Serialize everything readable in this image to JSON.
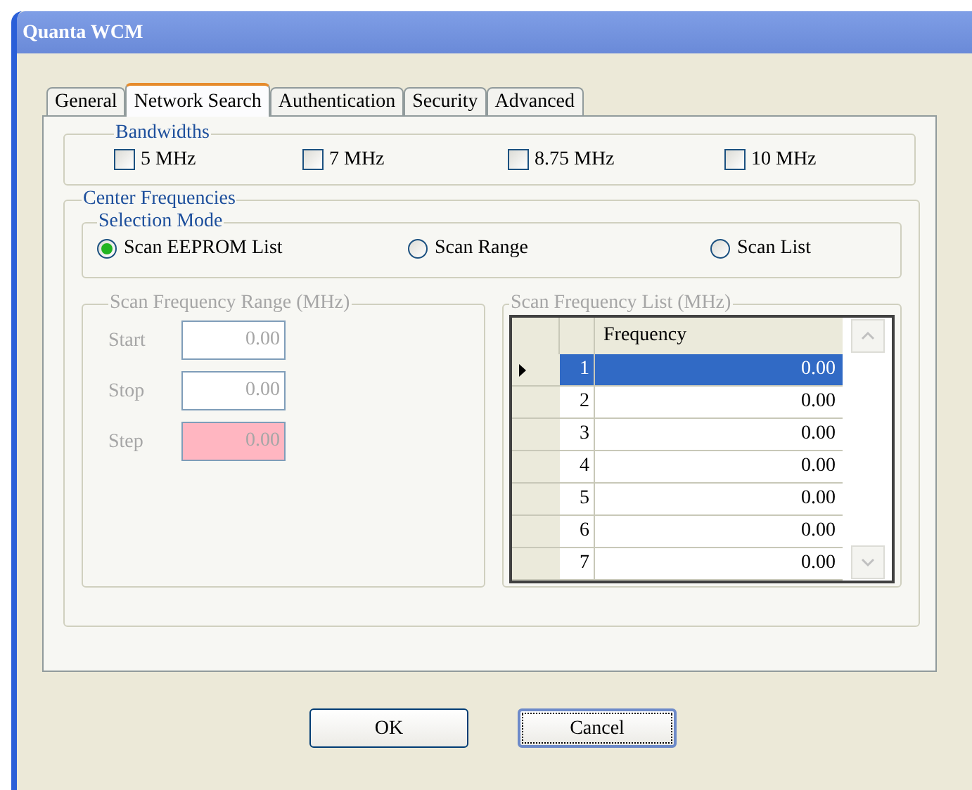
{
  "window": {
    "title": "Quanta WCM"
  },
  "tabs": [
    {
      "label": "General",
      "selected": false
    },
    {
      "label": "Network Search",
      "selected": true
    },
    {
      "label": "Authentication",
      "selected": false
    },
    {
      "label": "Security",
      "selected": false
    },
    {
      "label": "Advanced",
      "selected": false
    }
  ],
  "bandwidths": {
    "title": "Bandwidths",
    "options": [
      {
        "label": "5 MHz",
        "checked": false
      },
      {
        "label": "7 MHz",
        "checked": false
      },
      {
        "label": "8.75 MHz",
        "checked": false
      },
      {
        "label": "10 MHz",
        "checked": false
      }
    ]
  },
  "center_frequencies": {
    "title": "Center Frequencies",
    "selection_mode": {
      "title": "Selection Mode",
      "options": [
        {
          "label": "Scan EEPROM List",
          "selected": true
        },
        {
          "label": "Scan Range",
          "selected": false
        },
        {
          "label": "Scan List",
          "selected": false
        }
      ]
    },
    "scan_range": {
      "title": "Scan Frequency Range (MHz)",
      "disabled": true,
      "fields": [
        {
          "label": "Start",
          "value": "0.00",
          "invalid": false
        },
        {
          "label": "Stop",
          "value": "0.00",
          "invalid": false
        },
        {
          "label": "Step",
          "value": "0.00",
          "invalid": true
        }
      ]
    },
    "scan_list": {
      "title": "Scan Frequency List (MHz)",
      "disabled": true,
      "columns": [
        "Frequency"
      ],
      "rows": [
        {
          "index": "1",
          "frequency": "0.00",
          "selected": true
        },
        {
          "index": "2",
          "frequency": "0.00",
          "selected": false
        },
        {
          "index": "3",
          "frequency": "0.00",
          "selected": false
        },
        {
          "index": "4",
          "frequency": "0.00",
          "selected": false
        },
        {
          "index": "5",
          "frequency": "0.00",
          "selected": false
        },
        {
          "index": "6",
          "frequency": "0.00",
          "selected": false
        },
        {
          "index": "7",
          "frequency": "0.00",
          "selected": false
        }
      ]
    }
  },
  "buttons": [
    {
      "label": "OK",
      "focused": false
    },
    {
      "label": "Cancel",
      "focused": true
    }
  ]
}
